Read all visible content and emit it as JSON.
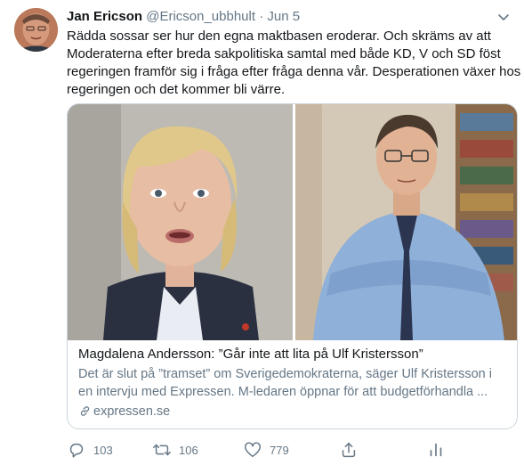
{
  "tweet": {
    "author_name": "Jan Ericson",
    "handle": "@Ericson_ubbhult",
    "separator": "·",
    "date": "Jun 5",
    "text_lines": [
      "Rädda sossar ser hur den egna maktbasen eroderar. Och skräms av att",
      "Moderaterna efter breda sakpolitiska samtal med både KD, V och SD föst",
      "regeringen framför sig i fråga efter fråga denna vår. Desperationen växer hos",
      "regeringen och det kommer bli värre."
    ]
  },
  "card": {
    "title": "Magdalena Andersson: ”Går inte att lita på Ulf Kristersson”",
    "description_lines": [
      "Det är slut på ”tramset” om Sverigedemokraterna, säger Ulf Kristersson i",
      "en intervju med Expressen. M-ledaren öppnar för att budgetförhandla ..."
    ],
    "domain": "expressen.se"
  },
  "actions": {
    "reply_count": "103",
    "retweet_count": "106",
    "like_count": "779"
  },
  "colors": {
    "text": "#14171a",
    "muted": "#657786",
    "border": "#ccd6dd"
  }
}
